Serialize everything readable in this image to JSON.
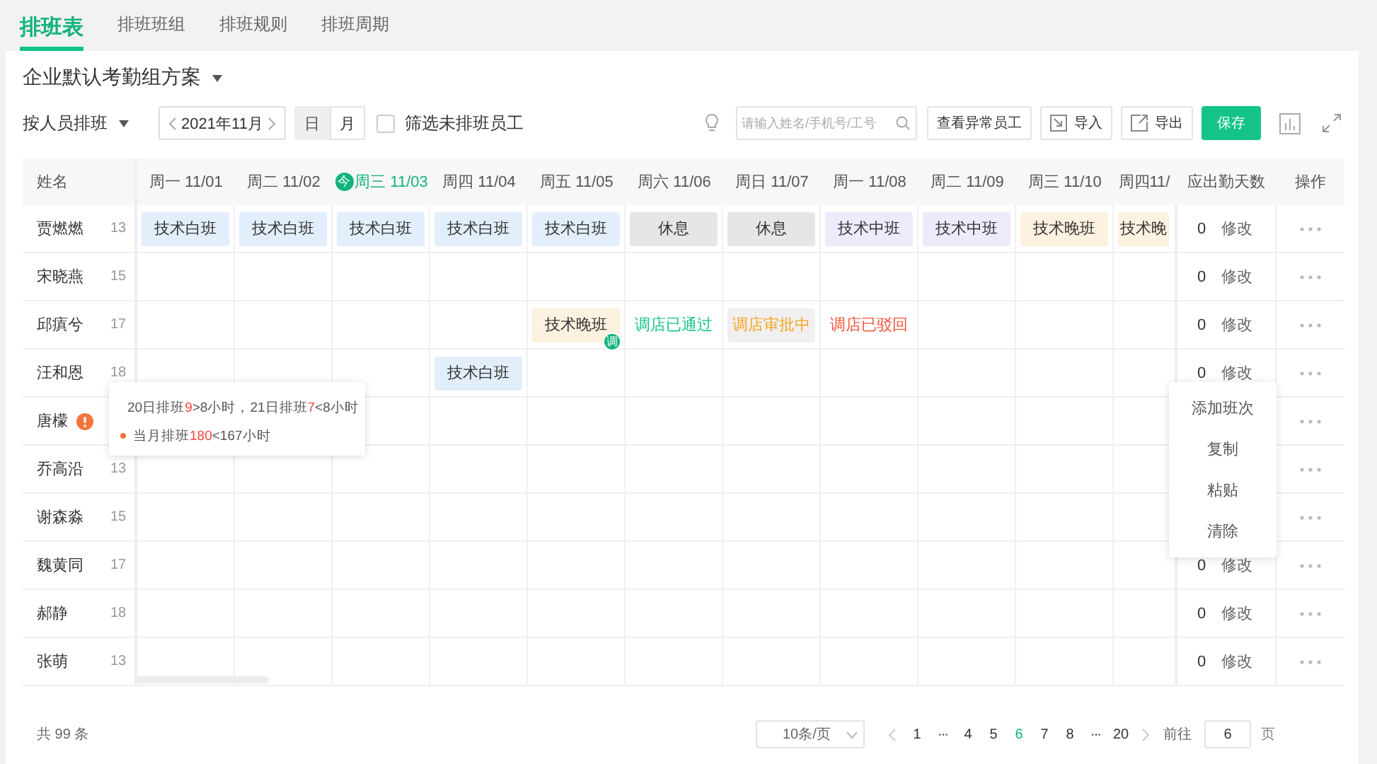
{
  "tabs": [
    {
      "label": "排班表",
      "selected": true
    },
    {
      "label": "排班班组",
      "selected": false
    },
    {
      "label": "排班规则",
      "selected": false
    },
    {
      "label": "排班周期",
      "selected": false
    }
  ],
  "scheme": {
    "title": "企业默认考勤组方案"
  },
  "toolbar": {
    "mode": "按人员排班",
    "month": "2021年11月",
    "views": [
      {
        "label": "日",
        "selected": false
      },
      {
        "label": "月",
        "selected": true
      }
    ],
    "filter": {
      "label": "筛选未排班员工",
      "checked": false
    },
    "search": {
      "placeholder": "请输入姓名/手机号/工号"
    },
    "buttons": [
      {
        "label": "查看异常员工",
        "kind": "plain"
      },
      {
        "label": "导入",
        "kind": "import"
      },
      {
        "label": "导出",
        "kind": "export"
      },
      {
        "label": "保存",
        "kind": "primary"
      }
    ]
  },
  "table": {
    "columns": {
      "name": "姓名",
      "due": "应出勤天数",
      "actions": "操作",
      "days": [
        {
          "label": "周一 11/01",
          "today": false
        },
        {
          "label": "周二 11/02",
          "today": false
        },
        {
          "label": "周三 11/03",
          "today": true,
          "mark": "今"
        },
        {
          "label": "周四 11/04",
          "today": false
        },
        {
          "label": "周五 11/05",
          "today": false
        },
        {
          "label": "周六 11/06",
          "today": false
        },
        {
          "label": "周日 11/07",
          "today": false
        },
        {
          "label": "周一 11/08",
          "today": false
        },
        {
          "label": "周二 11/09",
          "today": false
        },
        {
          "label": "周三 11/10",
          "today": false
        },
        {
          "label": "周四11/",
          "today": false
        }
      ]
    },
    "rows": [
      {
        "name": "贾燃燃",
        "number": "13",
        "warning": false,
        "due": "0",
        "edit": "修改",
        "cells": [
          {
            "kind": "shift",
            "color": "#e3eefc",
            "label": "技术白班"
          },
          {
            "kind": "shift",
            "color": "#e3eefc",
            "label": "技术白班"
          },
          {
            "kind": "shift",
            "color": "#e3eefc",
            "label": "技术白班"
          },
          {
            "kind": "shift",
            "color": "#e3eefc",
            "label": "技术白班"
          },
          {
            "kind": "shift",
            "color": "#e3eefc",
            "label": "技术白班"
          },
          {
            "kind": "shift",
            "color": "#e6e6e6",
            "label": "休息"
          },
          {
            "kind": "shift",
            "color": "#e6e6e6",
            "label": "休息"
          },
          {
            "kind": "shift",
            "color": "#eeeafc",
            "label": "技术中班"
          },
          {
            "kind": "shift",
            "color": "#eeeafc",
            "label": "技术中班"
          },
          {
            "kind": "shift",
            "color": "#fdf1df",
            "label": "技术晚班"
          },
          {
            "kind": "shift",
            "color": "#fdf1df",
            "label": "技术晚"
          }
        ]
      },
      {
        "name": "宋晓燕",
        "number": "15",
        "warning": false,
        "due": "0",
        "edit": "修改",
        "cells": [
          null,
          null,
          null,
          null,
          null,
          null,
          null,
          null,
          null,
          null,
          null
        ]
      },
      {
        "name": "邱瘨兮",
        "number": "17",
        "warning": false,
        "due": "0",
        "edit": "修改",
        "cells": [
          null,
          null,
          null,
          null,
          {
            "kind": "shift",
            "color": "#fdf1df",
            "label": "技术晚班",
            "badge": "调"
          },
          {
            "kind": "status",
            "color": "#13c486",
            "highlighted": false,
            "label": "调店已通过"
          },
          {
            "kind": "status",
            "color": "#f5a623",
            "highlighted": true,
            "label": "调店审批中"
          },
          {
            "kind": "status",
            "color": "#f5543c",
            "highlighted": false,
            "label": "调店已驳回"
          },
          null,
          null,
          null
        ]
      },
      {
        "name": "汪和恩",
        "number": "18",
        "warning": false,
        "due": "0",
        "edit": "修改",
        "cells": [
          null,
          null,
          null,
          {
            "kind": "shift",
            "color": "#e3eefc",
            "label": "技术白班"
          },
          null,
          null,
          null,
          null,
          null,
          null,
          null
        ]
      },
      {
        "name": "唐檬",
        "warning": true,
        "cells": [
          null,
          null,
          null,
          null,
          null,
          null,
          null,
          null,
          null,
          null,
          null
        ]
      },
      {
        "name": "乔高沿",
        "number": "13",
        "warning": false,
        "cells": [
          null,
          null,
          null,
          null,
          null,
          null,
          null,
          null,
          null,
          null,
          null
        ]
      },
      {
        "name": "谢森淼",
        "number": "15",
        "warning": false,
        "cells": [
          null,
          null,
          null,
          null,
          null,
          null,
          null,
          null,
          null,
          null,
          null
        ]
      },
      {
        "name": "魏黄同",
        "number": "17",
        "warning": false,
        "due": "0",
        "edit": "修改",
        "cells": [
          null,
          null,
          null,
          null,
          null,
          null,
          null,
          null,
          null,
          null,
          null
        ]
      },
      {
        "name": "郝静",
        "number": "18",
        "warning": false,
        "due": "0",
        "edit": "修改",
        "cells": [
          null,
          null,
          null,
          null,
          null,
          null,
          null,
          null,
          null,
          null,
          null
        ]
      },
      {
        "name": "张萌",
        "number": "13",
        "warning": false,
        "due": "0",
        "edit": "修改",
        "cells": [
          null,
          null,
          null,
          null,
          null,
          null,
          null,
          null,
          null,
          null,
          null
        ]
      }
    ]
  },
  "tooltip": {
    "lines": [
      [
        {
          "text": "20日排班",
          "alert": false
        },
        {
          "text": "9",
          "alert": true
        },
        {
          "text": ">8小时，21日排班",
          "alert": false
        },
        {
          "text": "7",
          "alert": true
        },
        {
          "text": "<8小时",
          "alert": false
        }
      ],
      [
        {
          "text": "当月排班",
          "alert": false
        },
        {
          "text": "180",
          "alert": true
        },
        {
          "text": "<167小时",
          "alert": false
        }
      ]
    ]
  },
  "context_menu": {
    "items": [
      "添加班次",
      "复制",
      "粘贴",
      "清除"
    ]
  },
  "footer": {
    "total": "共 99 条",
    "page_size": "10条/页",
    "pages": [
      {
        "label": "1",
        "kind": "page",
        "selected": false
      },
      {
        "label": "···",
        "kind": "more",
        "selected": false
      },
      {
        "label": "4",
        "kind": "page",
        "selected": false
      },
      {
        "label": "5",
        "kind": "page",
        "selected": false
      },
      {
        "label": "6",
        "kind": "page",
        "selected": true
      },
      {
        "label": "7",
        "kind": "page",
        "selected": false
      },
      {
        "label": "8",
        "kind": "page",
        "selected": false
      },
      {
        "label": "···",
        "kind": "more",
        "selected": false
      },
      {
        "label": "20",
        "kind": "page",
        "selected": false
      }
    ],
    "goto_label": "前往",
    "goto_value": "6",
    "page_suffix": "页"
  }
}
